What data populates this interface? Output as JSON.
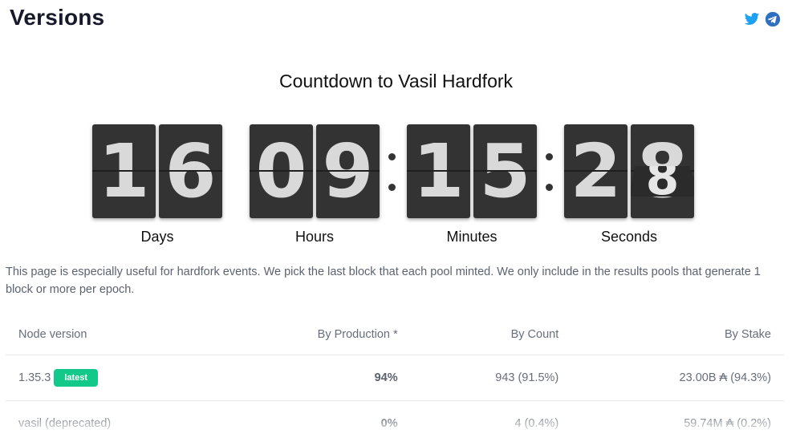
{
  "header": {
    "title": "Versions"
  },
  "social": {
    "twitter_icon": "twitter-icon",
    "telegram_icon": "telegram-icon",
    "twitter_color": "#1da1f2",
    "telegram_color": "#2f6fbf"
  },
  "countdown": {
    "title": "Countdown to Vasil Hardfork",
    "groups": [
      {
        "label": "Days",
        "digits": [
          "1",
          "6"
        ]
      },
      {
        "label": "Hours",
        "digits": [
          "0",
          "9"
        ]
      },
      {
        "label": "Minutes",
        "digits": [
          "1",
          "5"
        ]
      },
      {
        "label": "Seconds",
        "digits": [
          "2",
          "8"
        ],
        "flipping_digit": "8"
      }
    ]
  },
  "description": "This page is especially useful for hardfork events. We pick the last block that each pool minted. We only include in the results pools that generate 1 block or more per epoch.",
  "table": {
    "headers": [
      "Node version",
      "By Production *",
      "By Count",
      "By Stake"
    ],
    "rows": [
      {
        "version": "1.35.3",
        "badge": "latest",
        "production": "94%",
        "count": "943 (91.5%)",
        "stake": "23.00B ₳ (94.3%)"
      },
      {
        "version": "vasil (deprecated)",
        "badge": "",
        "production": "0%",
        "count": "4 (0.4%)",
        "stake": "59.74M ₳ (0.2%)"
      }
    ]
  },
  "colors": {
    "badge": "#12c98a",
    "card": "#333333"
  }
}
